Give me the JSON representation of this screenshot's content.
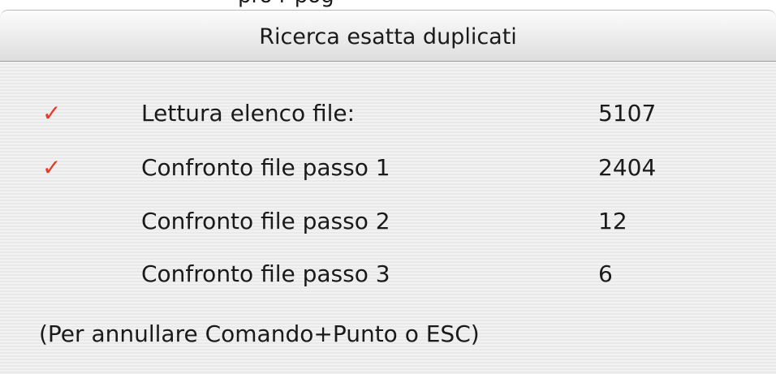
{
  "window": {
    "title": "Ricerca esatta duplicati"
  },
  "background_strip": {
    "partial_text": "pro  r  pog   "
  },
  "steps": [
    {
      "label": "Lettura elenco file:",
      "value": "5107",
      "done": true
    },
    {
      "label": "Confronto file passo 1",
      "value": "2404",
      "done": true
    },
    {
      "label": "Confronto file passo 2",
      "value": "12",
      "done": false
    },
    {
      "label": "Confronto file passo 3",
      "value": "6",
      "done": false
    }
  ],
  "check_glyph": "✓",
  "check_color": "#e23b2c",
  "hint": "(Per annullare Comando+Punto o ESC)"
}
